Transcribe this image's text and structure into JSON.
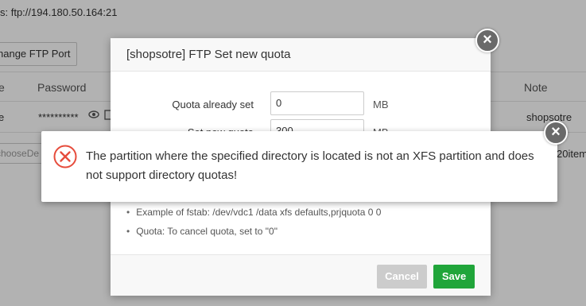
{
  "page": {
    "ftp_address": "s:  ftp://194.180.50.164:21",
    "change_port_label": "hange FTP Port",
    "columns": {
      "col_e": "e",
      "password": "Password",
      "note": "Note"
    },
    "row": {
      "col_e": "e",
      "password_mask": "**********",
      "note": "shopsotre"
    },
    "pager_input_placeholder": "chooseDe",
    "pager_items": "20item"
  },
  "modal": {
    "title": "[shopsotre] FTP Set new quota",
    "close_icon": "close-icon",
    "fields": [
      {
        "label": "Quota already set",
        "value": "0",
        "unit": "MB"
      },
      {
        "label": "Set new quota",
        "value": "300",
        "unit": "MB"
      }
    ],
    "tips": [
      "Example of fstab: /dev/vdc1 /data xfs defaults,prjquota 0 0",
      "Quota: To cancel quota, set to \"0\""
    ],
    "cancel_label": "Cancel",
    "save_label": "Save"
  },
  "toast": {
    "icon": "error-x-icon",
    "message": "The partition where the specified directory is located is not an XFS partition and does not support directory quotas!",
    "close_icon": "close-icon"
  },
  "colors": {
    "save_green": "#20a53a",
    "error_red": "#e64c3c",
    "cancel_gray": "#cccccc"
  }
}
